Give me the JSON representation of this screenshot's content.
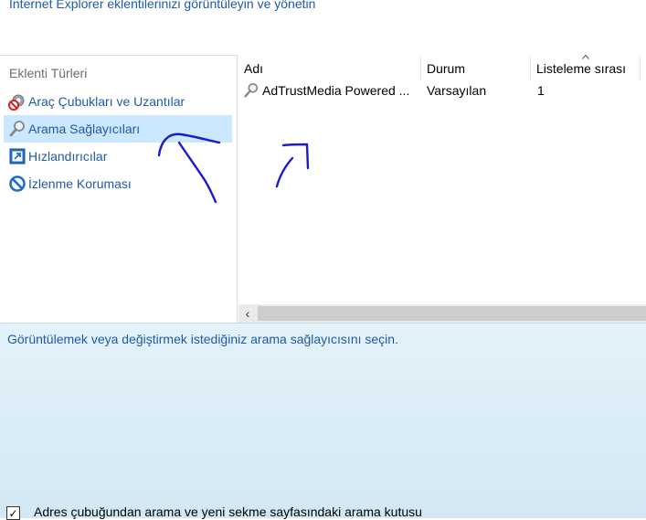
{
  "header": {
    "text": "Internet Explorer eklentilerinizi görüntüleyin ve yönetin"
  },
  "addon_types": {
    "title": "Eklenti Türleri",
    "items": [
      {
        "label": "Araç Çubukları ve Uzantılar",
        "icon": "toolbar-gear-icon",
        "selected": false
      },
      {
        "label": "Arama Sağlayıcıları",
        "icon": "search-magnifier-icon",
        "selected": true
      },
      {
        "label": "Hızlandırıcılar",
        "icon": "accelerator-icon",
        "selected": false
      },
      {
        "label": "İzlenme Koruması",
        "icon": "tracking-protection-icon",
        "selected": false
      }
    ]
  },
  "list": {
    "columns": [
      "Adı",
      "Durum",
      "Listeleme sırası"
    ],
    "rows": [
      {
        "name": "AdTrustMedia Powered ...",
        "status": "Varsayılan",
        "order": "1",
        "icon": "search-magnifier-icon"
      }
    ]
  },
  "details": {
    "prompt": "Görüntülemek veya değiştirmek istediğiniz arama sağlayıcısını seçin.",
    "checkbox_label": "Adres çubuğundan arama ve yeni sekme sayfasındaki arama kutusu",
    "checkbox_checked": true
  },
  "colors": {
    "link_blue": "#1e5aa8",
    "selection": "#cce8ff",
    "annotation_ink": "#1a1ad0"
  }
}
